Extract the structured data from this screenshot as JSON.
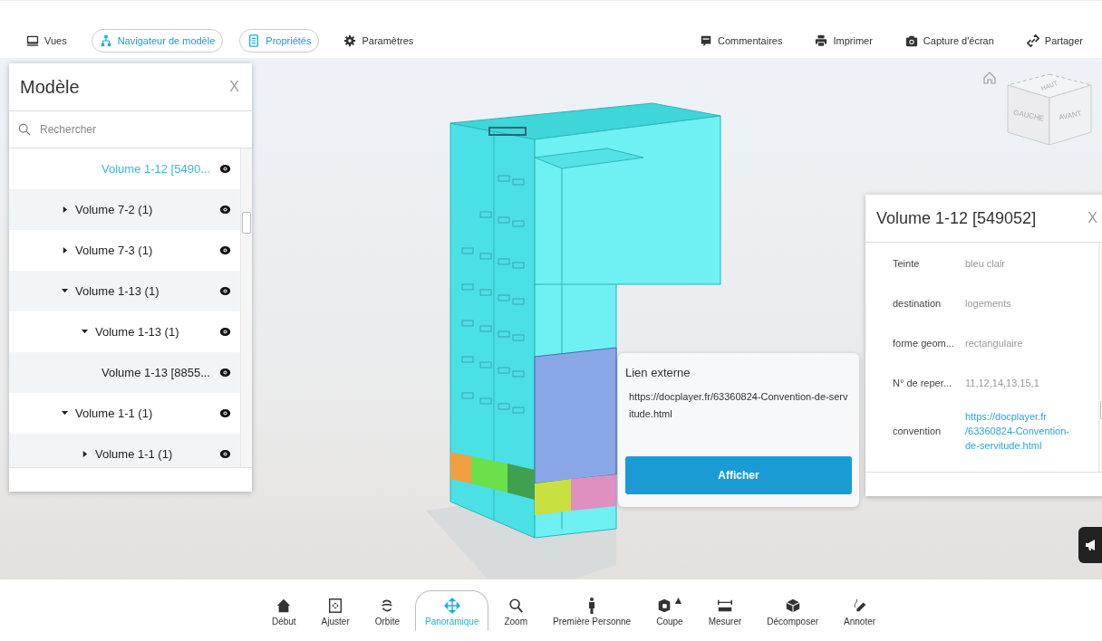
{
  "toolbar": {
    "left": [
      {
        "label": "Vues",
        "selected": false
      },
      {
        "label": "Navigateur de modèle",
        "selected": true
      },
      {
        "label": "Propriétés",
        "selected": true
      },
      {
        "label": "Paramètres",
        "selected": false
      }
    ],
    "right": [
      {
        "label": "Commentaires"
      },
      {
        "label": "Imprimer"
      },
      {
        "label": "Capture d'écran"
      },
      {
        "label": "Partager"
      }
    ]
  },
  "model_panel": {
    "title": "Modèle",
    "close": "X",
    "search": {
      "placeholder": "Rechercher"
    },
    "tree": [
      {
        "label": "Volume 1-12 [5490...",
        "selected": true
      },
      {
        "label": "Volume 7-2 (1)",
        "expanded": false,
        "selected": false
      },
      {
        "label": "Volume 7-3 (1)",
        "expanded": false,
        "selected": false
      },
      {
        "label": "Volume 1-13 (1)",
        "expanded": true,
        "selected": false,
        "children": [
          {
            "label": "Volume 1-13 (1)",
            "expanded": true,
            "selected": false,
            "children": [
              {
                "label": "Volume 1-13 [8855...",
                "selected": false
              }
            ]
          }
        ]
      },
      {
        "label": "Volume 1-1 (1)",
        "expanded": true,
        "selected": false,
        "children": [
          {
            "label": "Volume 1-1 (1)",
            "expanded": false,
            "selected": false
          }
        ]
      }
    ]
  },
  "viewcube": {
    "top": "HAUT",
    "left": "GAUCHE",
    "front": "AVANT"
  },
  "link_popup": {
    "title": "Lien externe",
    "url": "https://docplayer.fr/63360824-Convention-de-servitude.html",
    "button": "Afficher"
  },
  "properties_panel": {
    "title": "Volume 1-12 [549052]",
    "close": "X",
    "rows": [
      {
        "name": "Teinte",
        "value": "bleu clair",
        "kind": "text"
      },
      {
        "name": "destination",
        "value": "logements",
        "kind": "text"
      },
      {
        "name": "forme geom...",
        "value": "rectangulaire",
        "kind": "text"
      },
      {
        "name": "N° de reper...",
        "value": "11,12,14,13,15,1",
        "kind": "text"
      },
      {
        "name": "convention",
        "value": "https://docplayer.fr /63360824-Convention-de-servitude.html",
        "kind": "link"
      }
    ]
  },
  "bottom_toolbar": [
    {
      "label": "Début",
      "selected": false
    },
    {
      "label": "Ajuster",
      "selected": false
    },
    {
      "label": "Orbite",
      "selected": false
    },
    {
      "label": "Panoramique",
      "selected": true
    },
    {
      "label": "Zoom",
      "selected": false
    },
    {
      "label": "Première Personne",
      "selected": false
    },
    {
      "label": "Coupe",
      "selected": false
    },
    {
      "label": "Mesurer",
      "selected": false
    },
    {
      "label": "Décomposer",
      "selected": false
    },
    {
      "label": "Annoter",
      "selected": false
    }
  ]
}
